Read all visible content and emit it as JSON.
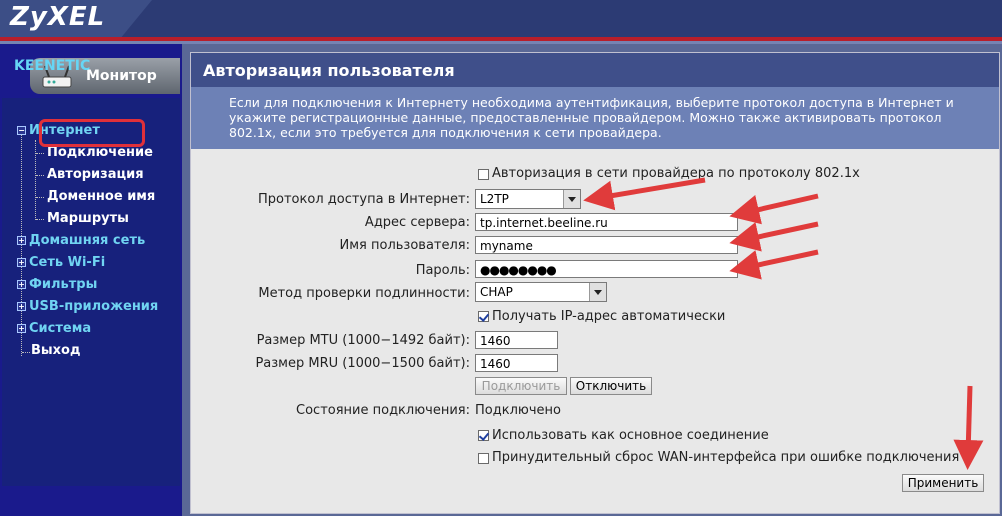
{
  "header": {
    "logo_text": "ZyXEL"
  },
  "sidebar": {
    "monitor_label": "Монитор",
    "brand": "KEENETIC",
    "items": [
      {
        "label": "Интернет"
      },
      {
        "label": "Подключение"
      },
      {
        "label": "Авторизация"
      },
      {
        "label": "Доменное имя"
      },
      {
        "label": "Маршруты"
      },
      {
        "label": "Домашняя сеть"
      },
      {
        "label": "Сеть Wi-Fi"
      },
      {
        "label": "Фильтры"
      },
      {
        "label": "USB-приложения"
      },
      {
        "label": "Система"
      },
      {
        "label": "Выход"
      }
    ]
  },
  "main": {
    "title": "Авторизация пользователя",
    "description": "Если для подключения к Интернету необходима аутентификация, выберите протокол доступа в Интернет и укажите регистрационные данные, предоставленные провайдером. Можно также активировать протокол 802.1x, если это требуется для подключения к сети провайдера.",
    "form": {
      "auth_8021x_label": "Авторизация в сети провайдера по протоколу 802.1x",
      "auth_8021x_checked": false,
      "protocol_label": "Протокол доступа в Интернет:",
      "protocol_value": "L2TP",
      "server_label": "Адрес сервера:",
      "server_value": "tp.internet.beeline.ru",
      "username_label": "Имя пользователя:",
      "username_value": "myname",
      "password_label": "Пароль:",
      "password_value": "●●●●●●●●",
      "auth_method_label": "Метод проверки подлинности:",
      "auth_method_value": "CHAP",
      "auto_ip_label": "Получать IP-адрес автоматически",
      "auto_ip_checked": true,
      "mtu_label": "Размер MTU (1000−1492 байт):",
      "mtu_value": "1460",
      "mru_label": "Размер MRU (1000−1500 байт):",
      "mru_value": "1460",
      "connect_button": "Подключить",
      "disconnect_button": "Отключить",
      "status_label": "Состояние подключения:",
      "status_value": "Подключено",
      "primary_label": "Использовать как основное соединение",
      "primary_checked": true,
      "force_reset_label": "Принудительный сброс WAN-интерфейса при ошибке подключения",
      "force_reset_checked": false,
      "apply_button": "Применить"
    }
  },
  "colors": {
    "annotation_arrow": "#e03b3b",
    "brand_cyan": "#66d6f6",
    "title_bar": "#3f4f8a"
  }
}
